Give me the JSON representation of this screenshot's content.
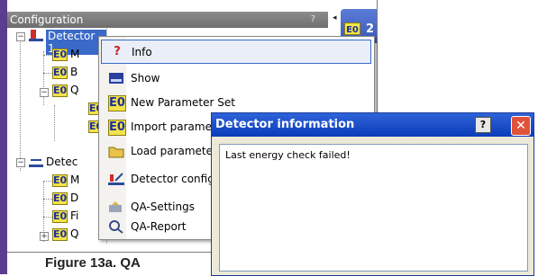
{
  "config_panel": {
    "title": "Configuration",
    "title_controls": "?",
    "pin_glyph": "◂",
    "right_tab_number": "2"
  },
  "tree": {
    "items": [
      {
        "label": "Detector 1",
        "icon": "detector-icon",
        "selected": true
      },
      {
        "label": "M",
        "icon": "parameter-icon"
      },
      {
        "label": "B",
        "icon": "parameter-icon"
      },
      {
        "label": "Q",
        "icon": "parameter-icon"
      },
      {
        "label": "",
        "icon": "parameter-icon"
      },
      {
        "label": "",
        "icon": "parameter-icon"
      },
      {
        "label": "Detec",
        "icon": "detector-icon"
      },
      {
        "label": "M",
        "icon": "parameter-icon"
      },
      {
        "label": "D",
        "icon": "parameter-icon"
      },
      {
        "label": "Fi",
        "icon": "parameter-icon"
      },
      {
        "label": "Q",
        "icon": "parameter-icon"
      }
    ]
  },
  "context_menu": {
    "items": [
      {
        "label": "Info",
        "icon": "info-icon"
      },
      {
        "label": "Show",
        "icon": "show-icon"
      },
      {
        "label": "New Parameter Set",
        "icon": "parameter-icon"
      },
      {
        "label": "Import paramete",
        "icon": "import-icon"
      },
      {
        "label": "Load parameter",
        "icon": "folder-icon"
      },
      {
        "label": "Detector configu",
        "icon": "detector-config-icon"
      },
      {
        "label": "QA-Settings",
        "icon": "qa-settings-icon"
      },
      {
        "label": "QA-Report",
        "icon": "qa-report-icon"
      }
    ]
  },
  "dialog": {
    "title": "Detector information",
    "help_label": "?",
    "close_label": "✕",
    "message": "Last energy check failed!"
  },
  "caption": "Figure 13a. QA",
  "colors": {
    "accent_bar": "#5b3d8f",
    "dialog_title": "#0a3cb8",
    "selection": "#3a6ac8",
    "close_button": "#e0533b"
  }
}
